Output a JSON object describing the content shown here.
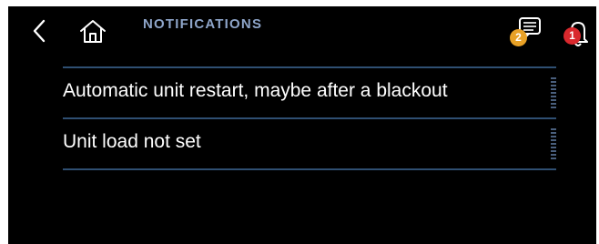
{
  "header": {
    "title": "NOTIFICATIONS",
    "back_icon": "chevron-left-icon",
    "home_icon": "home-icon",
    "messages": {
      "icon": "message-icon",
      "count": "2",
      "color": "#e8a126"
    },
    "alarms": {
      "icon": "bell-icon",
      "count": "1",
      "color": "#d9282d"
    }
  },
  "notifications": [
    {
      "text": "Automatic unit restart, maybe after a blackout"
    },
    {
      "text": "Unit load not set"
    }
  ],
  "colors": {
    "background": "#000000",
    "accent": "#8ea5c9",
    "divider": "#2f4f72"
  }
}
